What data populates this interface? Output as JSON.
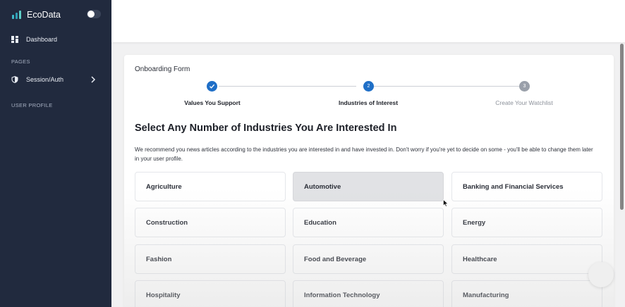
{
  "app": {
    "name": "EcoData"
  },
  "sidebar": {
    "dashboard_label": "Dashboard",
    "pages_section": "PAGES",
    "session_label": "Session/Auth",
    "user_profile_section": "USER PROFILE"
  },
  "form": {
    "title": "Onboarding Form",
    "steps": [
      {
        "label": "Values You Support",
        "number": "",
        "status": "completed"
      },
      {
        "label": "Industries of Interest",
        "number": "2",
        "status": "active"
      },
      {
        "label": "Create Your Watchlist",
        "number": "3",
        "status": "upcoming"
      }
    ],
    "heading": "Select Any Number of Industries You Are Interested In",
    "description": "We recommend you news articles according to the industries you are interested in and have invested in. Don't worry if you're yet to decide on some - you'll be able to change them later in your user profile.",
    "industries": [
      {
        "label": "Agriculture",
        "selected": false
      },
      {
        "label": "Automotive",
        "selected": true
      },
      {
        "label": "Banking and Financial Services",
        "selected": false
      },
      {
        "label": "Construction",
        "selected": false
      },
      {
        "label": "Education",
        "selected": false
      },
      {
        "label": "Energy",
        "selected": false
      },
      {
        "label": "Fashion",
        "selected": false
      },
      {
        "label": "Food and Beverage",
        "selected": false
      },
      {
        "label": "Healthcare",
        "selected": false
      },
      {
        "label": "Hospitality",
        "selected": false
      },
      {
        "label": "Information Technology",
        "selected": false
      },
      {
        "label": "Manufacturing",
        "selected": false
      }
    ]
  },
  "colors": {
    "sidebar_bg": "#212a3e",
    "accent": "#1f6fc7",
    "step_upcoming": "#9aa0aa",
    "tile_selected": "#e1e2e5"
  }
}
